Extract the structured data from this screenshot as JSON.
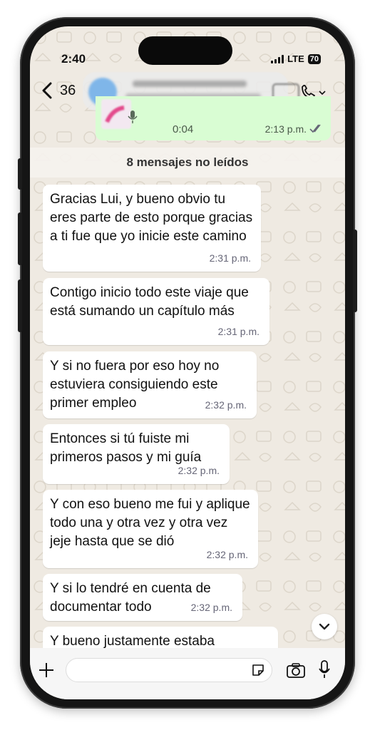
{
  "status_bar": {
    "time": "2:40",
    "network": "LTE",
    "battery": "70"
  },
  "header": {
    "back_count": "36"
  },
  "voice_message": {
    "duration": "0:04",
    "time": "2:13 p.m."
  },
  "unread_banner": "8 mensajes no leídos",
  "messages": [
    {
      "text": "Gracias Lui, y bueno obvio tu eres parte de esto porque gracias a ti fue que yo inicie este camino",
      "time": "2:31 p.m."
    },
    {
      "text": "Contigo inicio todo este viaje que está sumando un capítulo más",
      "time": "2:31 p.m."
    },
    {
      "text": "Y si no fuera por eso hoy no estuviera consiguiendo este primer empleo",
      "time": "2:32 p.m."
    },
    {
      "text": "Entonces si tú fuiste mi primeros pasos y mi guía",
      "time": "2:32 p.m."
    },
    {
      "text": "Y con eso bueno me fui y aplique todo una y otra vez y otra vez jeje hasta que se dió",
      "time": "2:32 p.m."
    },
    {
      "text": "Y si lo tendré en cuenta de documentar todo",
      "time": "2:32 p.m."
    },
    {
      "text": "Y bueno justamente estaba",
      "time": ""
    }
  ],
  "colors": {
    "chat_bg": "#efeae2",
    "outgoing_bubble": "#d9fdd3",
    "incoming_bubble": "#ffffff",
    "read_ticks": "#53bdeb"
  },
  "icons": [
    "back-icon",
    "phone-icon",
    "double-check-icon",
    "chevron-down-icon",
    "plus-icon",
    "sticker-icon",
    "camera-icon",
    "mic-icon"
  ]
}
